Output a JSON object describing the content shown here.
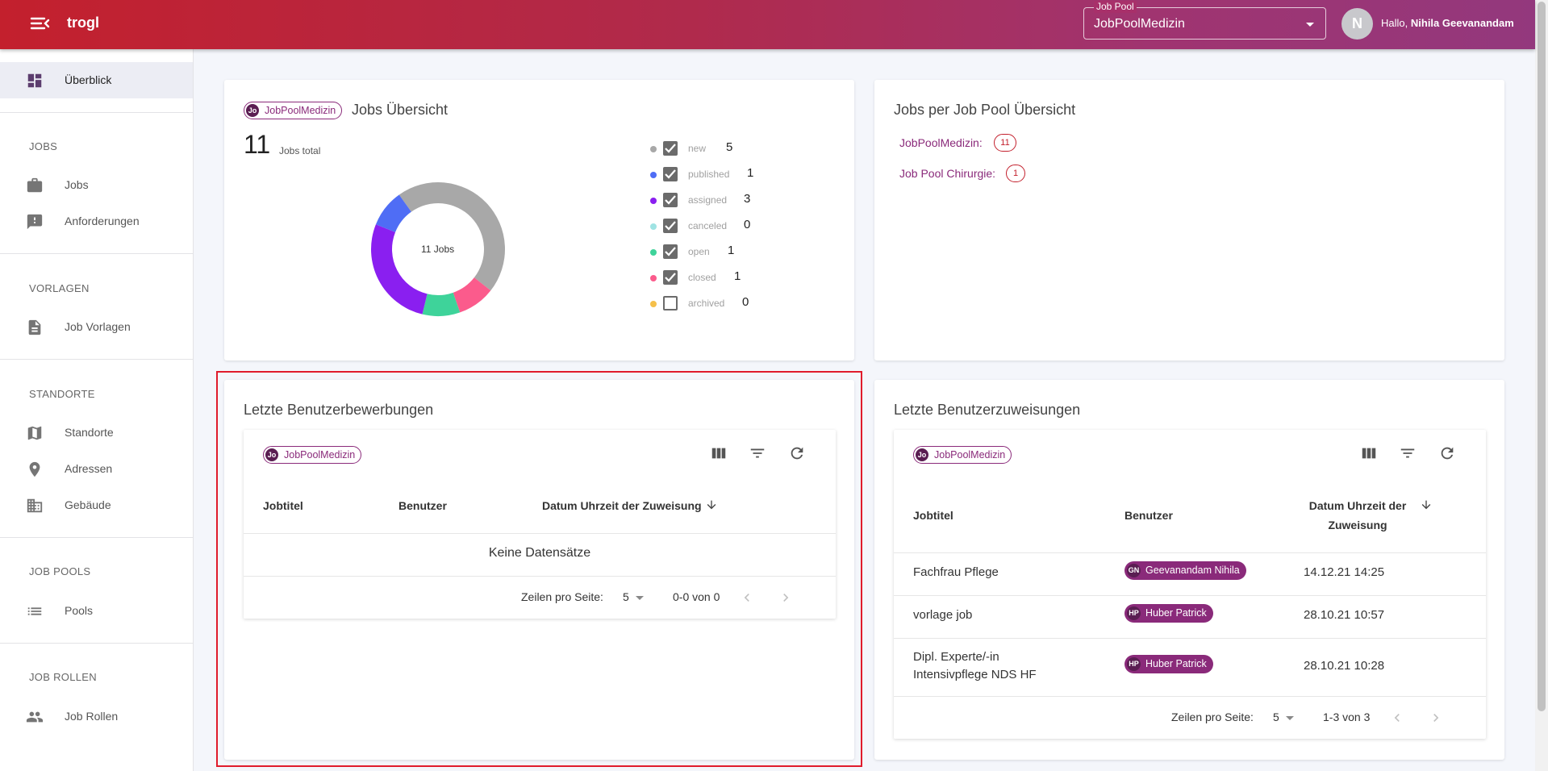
{
  "header": {
    "app_title": "trogl",
    "pool_select_label": "Job Pool",
    "pool_select_value": "JobPoolMedizin",
    "user_initial": "N",
    "greeting_prefix": "Hallo,",
    "user_name": "Nihila Geevanandam"
  },
  "sidebar": {
    "overview_label": "Überblick",
    "sections": {
      "jobs": "JOBS",
      "vorlagen": "VORLAGEN",
      "standorte": "STANDORTE",
      "job_pools": "JOB POOLS",
      "job_rollen": "JOB ROLLEN"
    },
    "items": {
      "jobs": "Jobs",
      "anforderungen": "Anforderungen",
      "job_vorlagen": "Job Vorlagen",
      "standorte": "Standorte",
      "adressen": "Adressen",
      "gebaeude": "Gebäude",
      "pools": "Pools",
      "job_rollen": "Job Rollen"
    }
  },
  "jobs_overview": {
    "chip_initials": "Jo",
    "chip_label": "JobPoolMedizin",
    "title": "Jobs Übersicht",
    "total_value": "11",
    "total_label": "Jobs total",
    "center_label": "11 Jobs",
    "legend": [
      {
        "name": "new",
        "count": "5",
        "color": "#a8a8a8",
        "checked": true
      },
      {
        "name": "published",
        "count": "1",
        "color": "#4f6df5",
        "checked": true
      },
      {
        "name": "assigned",
        "count": "3",
        "color": "#8a1ff0",
        "checked": true
      },
      {
        "name": "canceled",
        "count": "0",
        "color": "#9fe3e3",
        "checked": true
      },
      {
        "name": "open",
        "count": "1",
        "color": "#3ed39a",
        "checked": true
      },
      {
        "name": "closed",
        "count": "1",
        "color": "#fb5b8c",
        "checked": true
      },
      {
        "name": "archived",
        "count": "0",
        "color": "#f5c04a",
        "checked": false
      }
    ]
  },
  "pool_overview": {
    "title": "Jobs per Job Pool Übersicht",
    "pools": [
      {
        "name": "JobPoolMedizin:",
        "count": "11"
      },
      {
        "name": "Job Pool Chirurgie:",
        "count": "1"
      }
    ]
  },
  "applications": {
    "title": "Letzte Benutzerbewerbungen",
    "chip_initials": "Jo",
    "chip_label": "JobPoolMedizin",
    "columns": [
      "Jobtitel",
      "Benutzer",
      "Datum Uhrzeit der Zuweisung"
    ],
    "empty_text": "Keine Datensätze",
    "rows_per_page_label": "Zeilen pro Seite:",
    "rows_per_page": "5",
    "range": "0-0 von 0"
  },
  "assignments": {
    "title": "Letzte Benutzerzuweisungen",
    "chip_initials": "Jo",
    "chip_label": "JobPoolMedizin",
    "columns": [
      "Jobtitel",
      "Benutzer",
      "Datum Uhrzeit der",
      "Zuweisung"
    ],
    "rows": [
      {
        "job_line1": "Fachfrau Pflege",
        "job_line2": "",
        "user_initials": "GN",
        "user": "Geevanandam Nihila",
        "date": "14.12.21 14:25"
      },
      {
        "job_line1": "vorlage job",
        "job_line2": "",
        "user_initials": "HP",
        "user": "Huber Patrick",
        "date": "28.10.21 10:57"
      },
      {
        "job_line1": "Dipl. Experte/-in",
        "job_line2": "Intensivpflege NDS HF",
        "user_initials": "HP",
        "user": "Huber Patrick",
        "date": "28.10.21 10:28"
      }
    ],
    "rows_per_page_label": "Zeilen pro Seite:",
    "rows_per_page": "5",
    "range": "1-3 von 3"
  }
}
